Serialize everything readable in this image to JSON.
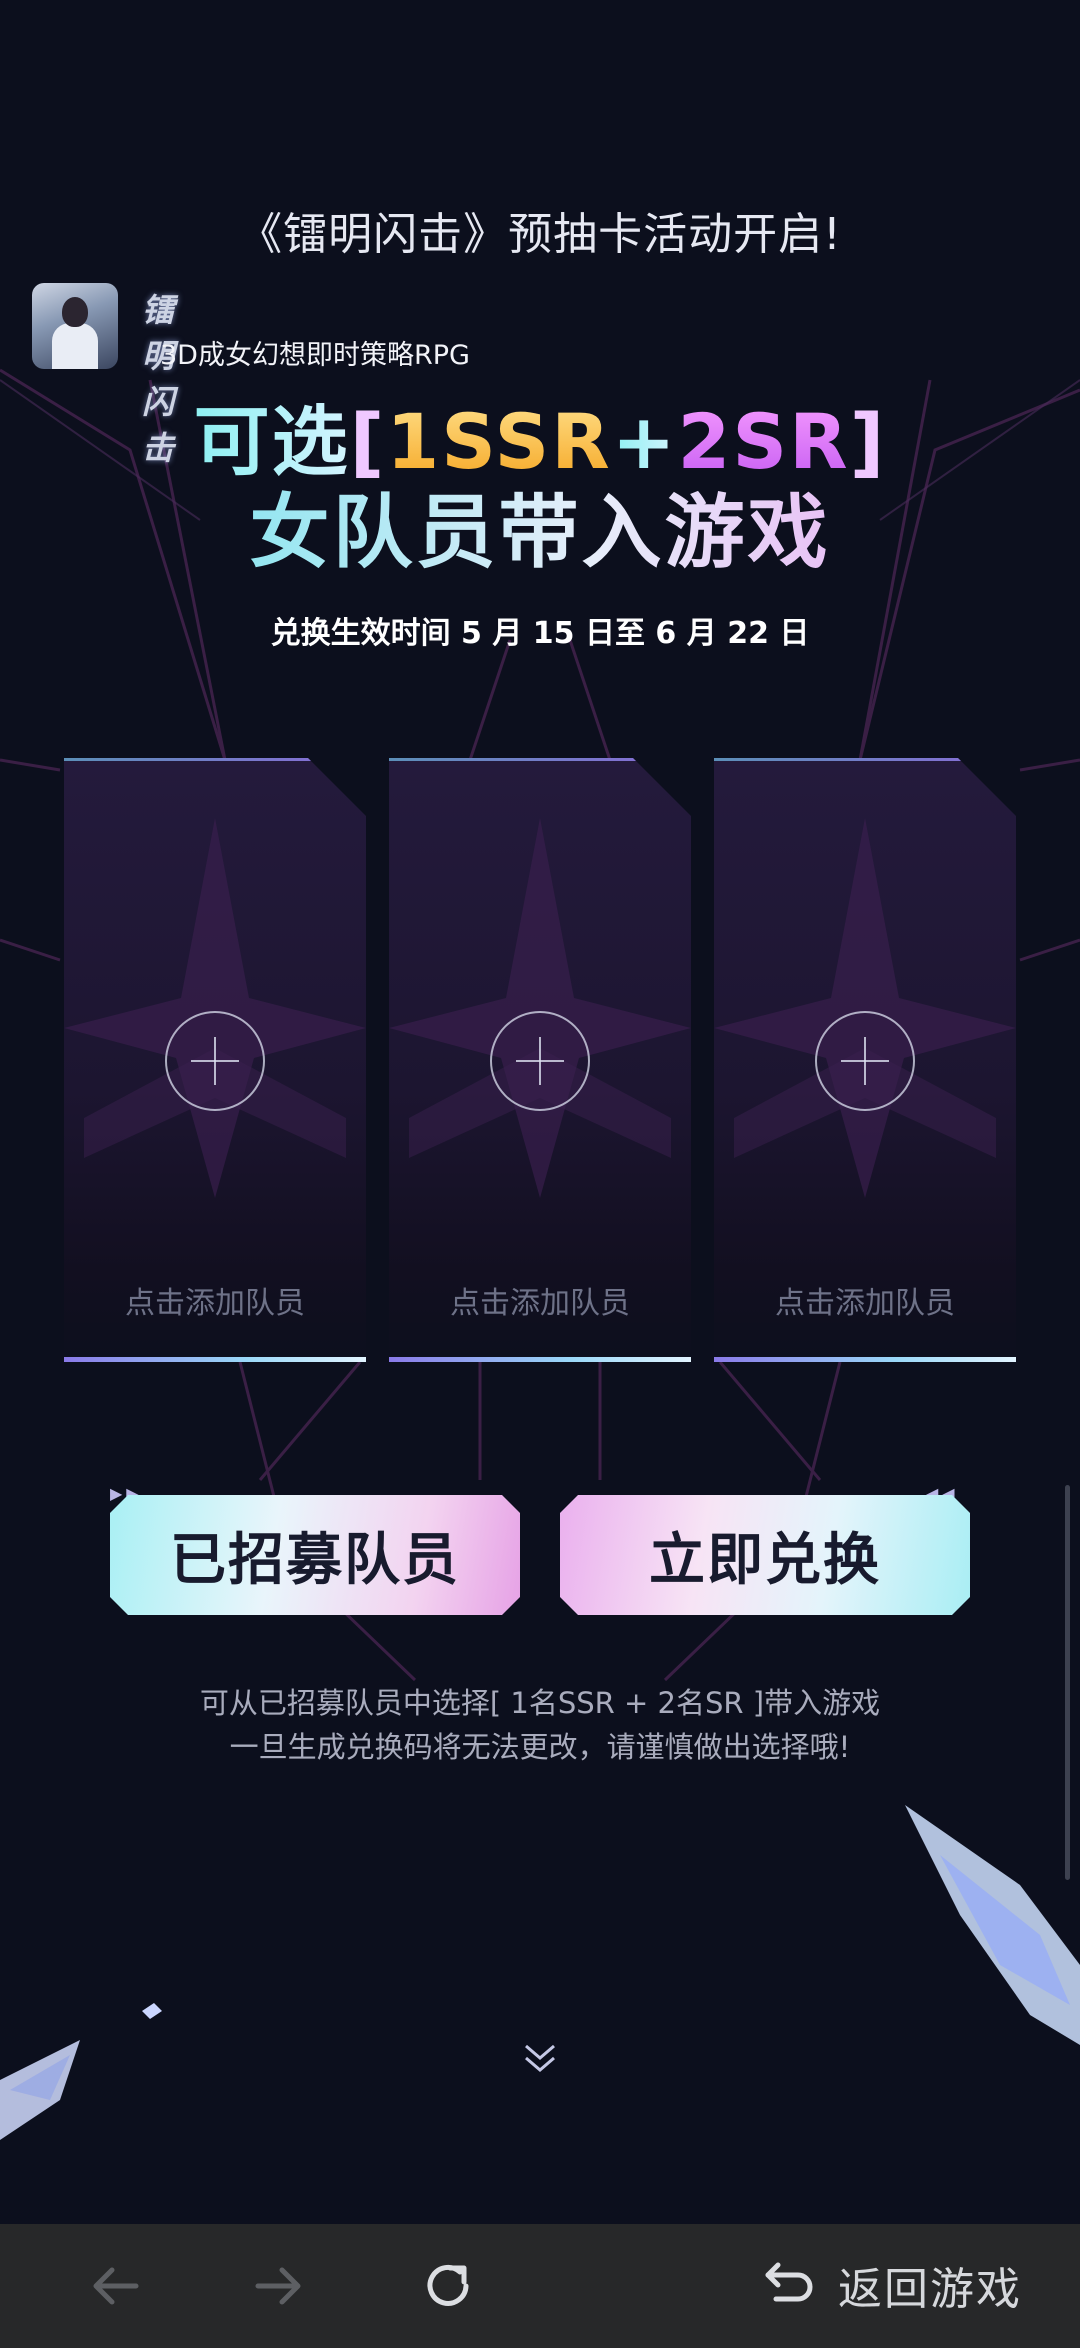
{
  "headline": "《镭明闪击》预抽卡活动开启!",
  "game": {
    "logo_text": "镭明闪击",
    "subtitle": "3D成女幻想即时策略RPG"
  },
  "title": {
    "prefix": "可选",
    "bracket_open": "[",
    "ssr": "1SSR",
    "plus": "+",
    "sr": "2SR",
    "bracket_close": "]",
    "line2": "女队员带入游戏"
  },
  "period": "兑换生效时间 5 月 15 日至 6 月 22 日",
  "slots": [
    {
      "label": "点击添加队员"
    },
    {
      "label": "点击添加队员"
    },
    {
      "label": "点击添加队员"
    }
  ],
  "buttons": {
    "recruited": "已招募队员",
    "redeem": "立即兑换"
  },
  "notes": {
    "line1": "可从已招募队员中选择[ 1名SSR + 2名SR ]带入游戏",
    "line2": "一旦生成兑换码将无法更改，请谨慎做出选择哦!"
  },
  "bottom_bar": {
    "back_icon": "arrow-left-icon",
    "forward_icon": "arrow-right-icon",
    "refresh_icon": "refresh-icon",
    "return_icon": "return-icon",
    "return_label": "返回游戏"
  }
}
